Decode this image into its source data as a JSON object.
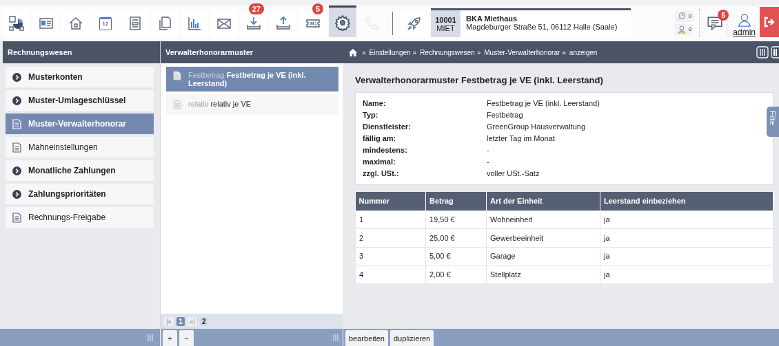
{
  "toolbar": [
    {
      "kind": "report",
      "selected": false,
      "disabled": false
    },
    {
      "kind": "card",
      "selected": false,
      "disabled": false
    },
    {
      "kind": "house",
      "selected": false,
      "disabled": false
    },
    {
      "kind": "calendar",
      "text": "12",
      "selected": false,
      "disabled": false
    },
    {
      "kind": "form",
      "selected": false,
      "disabled": false
    },
    {
      "kind": "copy",
      "selected": false,
      "disabled": false
    },
    {
      "kind": "chart",
      "selected": false,
      "disabled": false
    },
    {
      "kind": "envelope",
      "selected": false,
      "disabled": false
    },
    {
      "kind": "download",
      "badge": "27",
      "selected": false,
      "disabled": false
    },
    {
      "kind": "upload",
      "selected": false,
      "disabled": false
    },
    {
      "kind": "ticket",
      "badge": "5",
      "selected": false,
      "disabled": false
    },
    {
      "kind": "gear",
      "selected": true,
      "disabled": false
    },
    {
      "kind": "phone",
      "selected": false,
      "disabled": true
    },
    {
      "kind": "divider"
    },
    {
      "kind": "rocket",
      "selected": false,
      "disabled": false
    }
  ],
  "object": {
    "number": "10001",
    "type": "MIET",
    "name": "BKA Miethaus",
    "address": "Magdeburger Straße 51, 06112 Halle (Saale)"
  },
  "counters": [
    {
      "kind": "clock",
      "count": "0"
    },
    {
      "kind": "person",
      "count": "0"
    }
  ],
  "messages": {
    "badge": "5"
  },
  "user": {
    "name": "admin"
  },
  "sidebar": {
    "title": "Rechnungswesen",
    "items": [
      {
        "label": "Musterkonten",
        "kind": "group",
        "selected": false
      },
      {
        "label": "Muster-Umlageschlüssel",
        "kind": "group",
        "selected": false
      },
      {
        "label": "Muster-Verwalterhonorar",
        "kind": "page",
        "selected": true
      },
      {
        "label": "Mahneinstellungen",
        "kind": "page",
        "selected": false
      },
      {
        "label": "Monatliche Zahlungen",
        "kind": "group",
        "selected": false
      },
      {
        "label": "Zahlungsprioritäten",
        "kind": "group",
        "selected": false
      },
      {
        "label": "Rechnungs-Freigabe",
        "kind": "page",
        "selected": false
      }
    ]
  },
  "list": {
    "title": "Verwalterhonorarmuster",
    "items": [
      {
        "type": "Festbetrag",
        "name": "Festbetrag je VE (inkl. Leerstand)",
        "selected": true
      },
      {
        "type": "relativ",
        "name": "relativ je VE",
        "selected": false
      }
    ],
    "pager": [
      {
        "label": "|«",
        "kind": "nav",
        "selected": false
      },
      {
        "label": "1",
        "kind": "page",
        "selected": true
      },
      {
        "label": "»|",
        "kind": "nav",
        "selected": false
      },
      {
        "label": "2",
        "kind": "page",
        "selected": false
      }
    ]
  },
  "breadcrumb": [
    {
      "sep": "»",
      "label": "Einstellungen"
    },
    {
      "sep": "»",
      "label": "Rechnungswesen"
    },
    {
      "sep": "»",
      "label": "Muster-Verwalterhonorar"
    },
    {
      "sep": "»",
      "label": "anzeigen"
    }
  ],
  "detail": {
    "title": "Verwalterhonorarmuster Festbetrag je VE (inkl. Leerstand)",
    "properties": [
      {
        "label": "Name:",
        "value": "Festbetrag je VE (inkl. Leerstand)"
      },
      {
        "label": "Typ:",
        "value": "Festbetrag"
      },
      {
        "label": "Dienstleister:",
        "value": "GreenGroup Hausverwaltung"
      },
      {
        "label": "fällig am:",
        "value": "letzter Tag im Monat"
      },
      {
        "label": "mindestens:",
        "value": "-"
      },
      {
        "label": "maximal:",
        "value": "-"
      },
      {
        "label": "zzgl. USt.:",
        "value": "voller USt.-Satz"
      }
    ],
    "table": {
      "columns": [
        "Nummer",
        "Betrag",
        "Art der Einheit",
        "Leerstand einbeziehen"
      ],
      "rows": [
        [
          "1",
          "19,50 €",
          "Wohneinheit",
          "ja"
        ],
        [
          "2",
          "25,00 €",
          "Gewerbeeinheit",
          "ja"
        ],
        [
          "3",
          "5,00 €",
          "Garage",
          "ja"
        ],
        [
          "4",
          "2,00 €",
          "Stellplatz",
          "ja"
        ]
      ]
    }
  },
  "filter_tab": {
    "label": "Filte"
  },
  "bottom": {
    "list_buttons": [
      "+",
      "−"
    ],
    "detail_buttons": [
      "bearbeiten",
      "duplizieren"
    ]
  }
}
